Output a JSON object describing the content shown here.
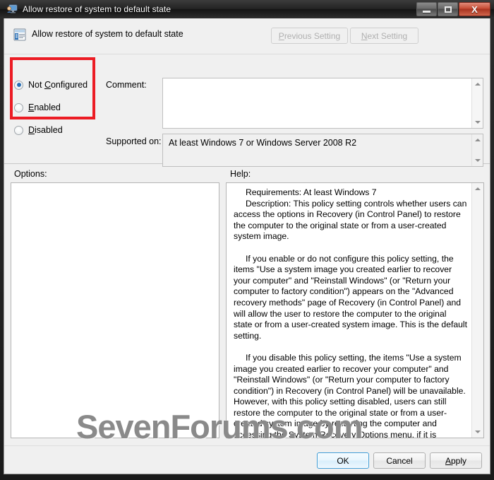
{
  "window": {
    "title": "Allow restore of system to default state",
    "title_icon": "policy-monitor-icon",
    "controls": {
      "minimize": "minimize-icon",
      "maximize": "maximize-icon",
      "close": "X"
    }
  },
  "header": {
    "icon": "policy-document-icon",
    "title": "Allow restore of system to default state",
    "previous_setting": "Previous Setting",
    "previous_setting_accesskey": "P",
    "next_setting": "Next Setting",
    "next_setting_accesskey": "N"
  },
  "state_options": {
    "selected": "Not Configured",
    "items": [
      {
        "label_before": "Not ",
        "accesskey": "C",
        "label_after": "onfigured",
        "full": "Not Configured",
        "checked": true
      },
      {
        "label_before": "",
        "accesskey": "E",
        "label_after": "nabled",
        "full": "Enabled",
        "checked": false
      },
      {
        "label_before": "",
        "accesskey": "D",
        "label_after": "isabled",
        "full": "Disabled",
        "checked": false
      }
    ],
    "highlight_color": "#ec1c24"
  },
  "comment": {
    "label": "Comment:",
    "value": "",
    "placeholder": ""
  },
  "supported_on": {
    "label": "Supported on:",
    "value": "At least Windows 7 or Windows Server 2008 R2"
  },
  "panes": {
    "options_label": "Options:",
    "options_content": "",
    "help_label": "Help:",
    "help_content": "     Requirements: At least Windows 7\n     Description: This policy setting controls whether users can access the options in Recovery (in Control Panel) to restore the computer to the original state or from a user-created system image.\n\n     If you enable or do not configure this policy setting, the items \"Use a system image you created earlier to recover your computer\" and \"Reinstall Windows\" (or \"Return your computer to factory condition\") appears on the \"Advanced recovery methods\" page of Recovery (in Control Panel) and will allow the user to restore the computer to the original state or from a user-created system image. This is the default setting.\n\n     If you disable this policy setting, the items \"Use a system image you created earlier to recover your computer\" and \"Reinstall Windows\" (or \"Return your computer to factory condition\") in Recovery (in Control Panel) will be unavailable. However, with this policy setting disabled, users can still restore the computer to the original state or from a user-created system image by restarting the computer and accessing the System Recovery Options menu, if it is available."
  },
  "footer": {
    "ok": "OK",
    "cancel": "Cancel",
    "apply": "Apply",
    "apply_accesskey": "A"
  },
  "watermark": {
    "text": "SevenForums.com"
  }
}
